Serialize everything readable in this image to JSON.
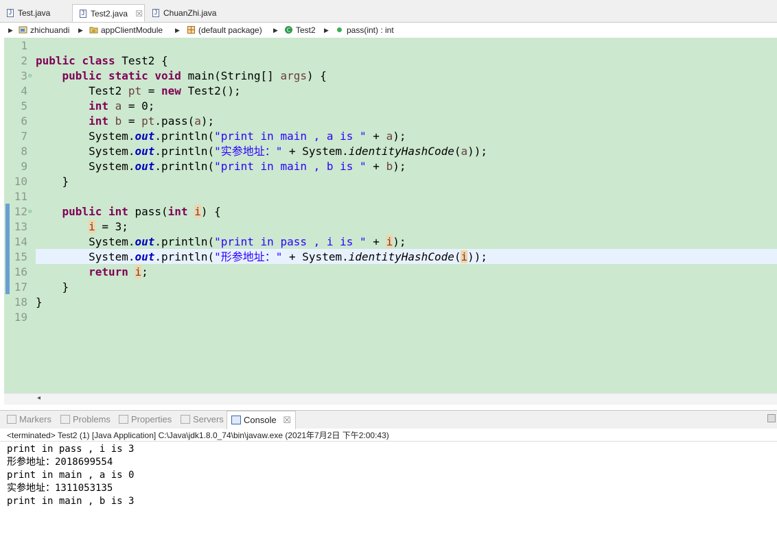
{
  "tabs": [
    {
      "label": "Test.java",
      "active": false
    },
    {
      "label": "Test2.java",
      "active": true,
      "close": "☒"
    },
    {
      "label": "ChuanZhi.java",
      "active": false
    }
  ],
  "breadcrumb": {
    "project": "zhichuandi",
    "module": "appClientModule",
    "package": "(default package)",
    "class": "Test2",
    "method": "pass(int) : int"
  },
  "code": {
    "line_numbers": [
      "1",
      "2",
      "3",
      "4",
      "5",
      "6",
      "7",
      "8",
      "9",
      "10",
      "11",
      "12",
      "13",
      "14",
      "15",
      "16",
      "17",
      "18",
      "19"
    ],
    "lines": [
      "",
      "public class Test2 {",
      "    public static void main(String[] args) {",
      "        Test2 pt = new Test2();",
      "        int a = 0;",
      "        int b = pt.pass(a);",
      "        System.out.println(\"print in main , a is \" + a);",
      "        System.out.println(\"实参地址：\" + System.identityHashCode(a));",
      "        System.out.println(\"print in main , b is \" + b);",
      "    }",
      "",
      "    public int pass(int i) {",
      "        i = 3;",
      "        System.out.println(\"print in pass , i is \" + i);",
      "        System.out.println(\"形参地址：\" + System.identityHashCode(i));",
      "        return i;",
      "    }",
      "}",
      ""
    ]
  },
  "console": {
    "view_tabs": [
      "Markers",
      "Problems",
      "Properties",
      "Servers",
      "Console"
    ],
    "close": "☒",
    "status": "<terminated> Test2 (1) [Java Application] C:\\Java\\jdk1.8.0_74\\bin\\javaw.exe (2021年7月2日 下午2:00:43)",
    "output": [
      "print in pass , i is 3",
      "形参地址：2018699554",
      "print in main , a is 0",
      "实参地址：1311053135",
      "print in main , b is 3"
    ]
  },
  "colors": {
    "editor_bg": "#cce8cf",
    "keyword": "#7f0055",
    "string": "#2a00ff",
    "field": "#0000c0"
  }
}
